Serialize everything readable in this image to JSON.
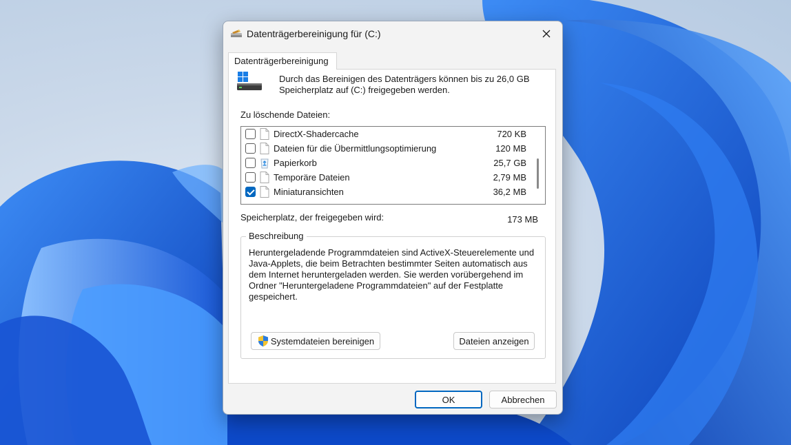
{
  "window": {
    "title": "Datenträgerbereinigung für  (C:)",
    "close_icon": "close-icon",
    "drive_icon": "drive-icon"
  },
  "tabs": [
    {
      "label": "Datenträgerbereinigung",
      "selected": true
    }
  ],
  "intro_text": "Durch das Bereinigen des Datenträgers können bis zu 26,0 GB Speicherplatz auf  (C:) freigegeben werden.",
  "files_label": "Zu löschende Dateien:",
  "files": [
    {
      "name": "DirectX-Shadercache",
      "size": "720 KB",
      "checked": false,
      "icon": "file-icon"
    },
    {
      "name": "Dateien für die Übermittlungsoptimierung",
      "size": "120 MB",
      "checked": false,
      "icon": "file-icon"
    },
    {
      "name": "Papierkorb",
      "size": "25,7 GB",
      "checked": false,
      "icon": "recycle-bin-icon"
    },
    {
      "name": "Temporäre Dateien",
      "size": "2,79 MB",
      "checked": false,
      "icon": "file-icon"
    },
    {
      "name": "Miniaturansichten",
      "size": "36,2 MB",
      "checked": true,
      "icon": "file-icon"
    }
  ],
  "space_gained_label": "Speicherplatz, der freigegeben wird:",
  "space_gained_value": "173 MB",
  "description": {
    "legend": "Beschreibung",
    "text": "Heruntergeladende Programmdateien sind ActiveX-Steuerelemente und Java-Applets, die beim Betrachten bestimmter Seiten automatisch aus dem Internet heruntergeladen werden. Sie werden vorübergehend im Ordner \"Heruntergeladene Programmdateien\" auf der Festplatte gespeichert."
  },
  "buttons": {
    "cleanup_system": "Systemdateien bereinigen",
    "view_files": "Dateien anzeigen",
    "ok": "OK",
    "cancel": "Abbrechen"
  },
  "colors": {
    "accent": "#0067c0",
    "wallpaper_blue": "#1a63e0"
  }
}
